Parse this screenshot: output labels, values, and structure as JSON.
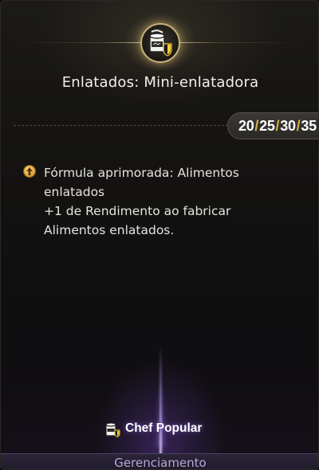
{
  "skill": {
    "title": "Enlatados: Mini-enlatadora",
    "icon": "canned-food-shield-icon",
    "levels": [
      "20",
      "25",
      "30",
      "35"
    ],
    "level_separator": "/"
  },
  "effect": {
    "icon": "upgrade-arrow-icon",
    "lines": [
      "Fórmula aprimorada: Alimentos",
      "enlatados",
      "+1 de Rendimento ao fabricar",
      "Alimentos enlatados."
    ]
  },
  "category": {
    "label": "Chef Popular",
    "icon": "chef-can-icon"
  },
  "footer": {
    "label": "Gerenciamento"
  },
  "colors": {
    "accent_gold": "#d4b04a",
    "accent_purple": "#b7a7d8"
  }
}
